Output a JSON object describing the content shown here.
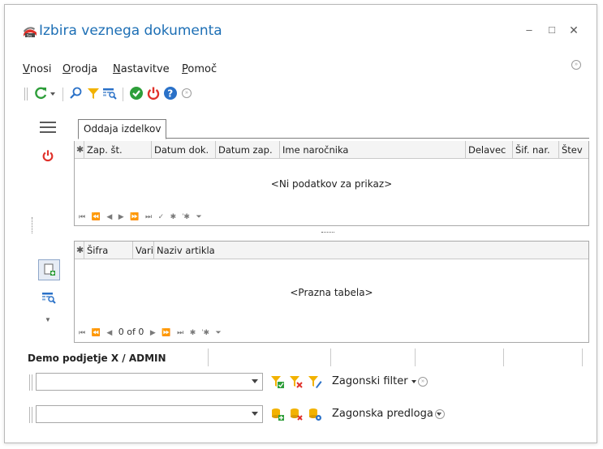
{
  "window": {
    "title": "Izbira veznega dokumenta",
    "controls": {
      "minimize": "–",
      "maximize": "□",
      "close": "✕"
    }
  },
  "menu": {
    "items": [
      {
        "label": "Vnosi",
        "underline": "V",
        "rest": "nosi"
      },
      {
        "label": "Orodja",
        "underline": "O",
        "rest": "rodja"
      },
      {
        "label": "Nastavitve",
        "underline": "N",
        "rest": "astavitve"
      },
      {
        "label": "Pomoč",
        "underline": "P",
        "rest": "omoč"
      }
    ]
  },
  "toolbar": {
    "icons": [
      "refresh-icon",
      "dropdown-arrow-icon",
      "search-icon",
      "filter-icon",
      "grid-search-icon",
      "confirm-icon",
      "power-icon",
      "help-icon",
      "more-icon"
    ]
  },
  "tabs": [
    {
      "label": "Oddaja izdelkov"
    }
  ],
  "top_grid": {
    "columns": [
      "✱",
      "Zap. št.",
      "Datum dok.",
      "Datum zap.",
      "Ime naročnika",
      "Delavec",
      "Šif. nar.",
      "Štev"
    ],
    "empty_message": "<Ni podatkov za prikaz>",
    "navigator": [
      "⏮",
      "⏪",
      "◀",
      "▶",
      "⏩",
      "⏭",
      "✓",
      "✱",
      "'✱",
      "⏷"
    ]
  },
  "bottom_grid": {
    "columns": [
      "✱",
      "Šifra",
      "Vari",
      "Naziv artikla"
    ],
    "empty_message": "<Prazna tabela>",
    "navigator_count": "0 of 0"
  },
  "status": {
    "company_user": "Demo podjetje X / ADMIN"
  },
  "filter_row": {
    "value": "",
    "label": "Zagonski filter"
  },
  "template_row": {
    "value": "",
    "label": "Zagonska predloga"
  },
  "colors": {
    "title": "#1d6fb5",
    "green": "#2e9e3a",
    "red": "#e0312a",
    "blue": "#2a71c8",
    "yellow": "#f2b200"
  }
}
